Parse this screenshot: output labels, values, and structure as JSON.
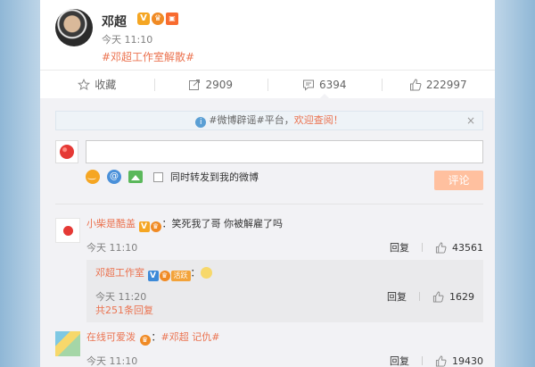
{
  "post": {
    "author": "邓超",
    "time": "今天 11:10",
    "topic": "#邓超工作室解散#"
  },
  "actions": [
    {
      "icon": "star-icon",
      "label": "收藏"
    },
    {
      "icon": "share-icon",
      "label": "2909"
    },
    {
      "icon": "comment-icon",
      "label": "6394"
    },
    {
      "icon": "thumb-up-icon",
      "label": "222997"
    }
  ],
  "composer": {
    "notice_prefix": "#微博辟谣#平台，",
    "notice_link": "欢迎查阅！",
    "notice_close": "×",
    "input_value": "",
    "repost_label": "同时转发到我的微博",
    "submit_label": "评论"
  },
  "comments": [
    {
      "user": "小柴是酷盖",
      "text": "：笑死我了哥 你被解雇了吗",
      "time": "今天 11:10",
      "reply_label": "回复",
      "likes": "43561",
      "reply": {
        "user": "邓超工作室",
        "tag": "活跃",
        "text": "：",
        "time": "今天 11:20",
        "reply_label": "回复",
        "likes": "1629"
      },
      "total_replies": "共251条回复"
    },
    {
      "user": "在线可爱泼",
      "text": "：",
      "topic": "#邓超 记仇#",
      "time": "今天 11:10",
      "reply_label": "回复",
      "likes": "19430"
    }
  ],
  "colors": {
    "accent": "#eb7350",
    "button_disabled": "#ffc09f",
    "panel": "#f2f2f5"
  }
}
